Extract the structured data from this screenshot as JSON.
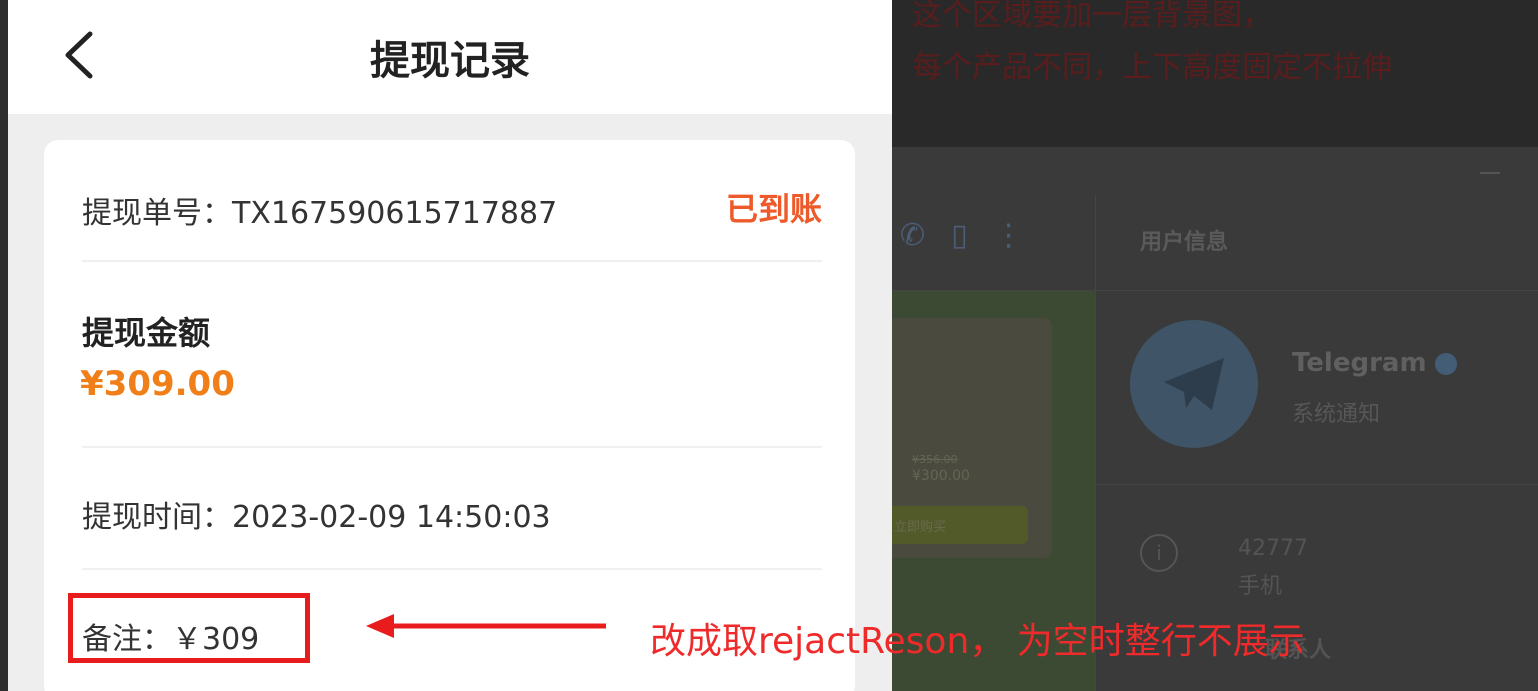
{
  "phone": {
    "nav": {
      "title": "提现记录",
      "back_icon": "chevron-left-icon"
    },
    "record": {
      "order_label": "提现单号：TX167590615717887",
      "status": "已到账",
      "amount_title": "提现金额",
      "amount_value": "¥309.00",
      "time_label": "提现时间：2023-02-09 14:50:03",
      "remark": "备注：￥309"
    }
  },
  "annotation": {
    "instruction": "改成取rejactReson，  为空时整行不展示"
  },
  "background_app": {
    "top_note": [
      "这个区域要加一层背景图，",
      "每个产品不同，上下高度固定不拉伸"
    ],
    "panel_title": "用户信息",
    "contact_name": "Telegram",
    "contact_subtitle": "系统通知",
    "phone_number": "42777",
    "phone_label": "手机",
    "section": "联系人",
    "price_strike": "¥356.00",
    "price": "¥300.00",
    "chat_button": "立即购买"
  },
  "colors": {
    "status": "#ee5a2a",
    "amount": "#f07f1a",
    "annotation": "#e81c1c"
  }
}
